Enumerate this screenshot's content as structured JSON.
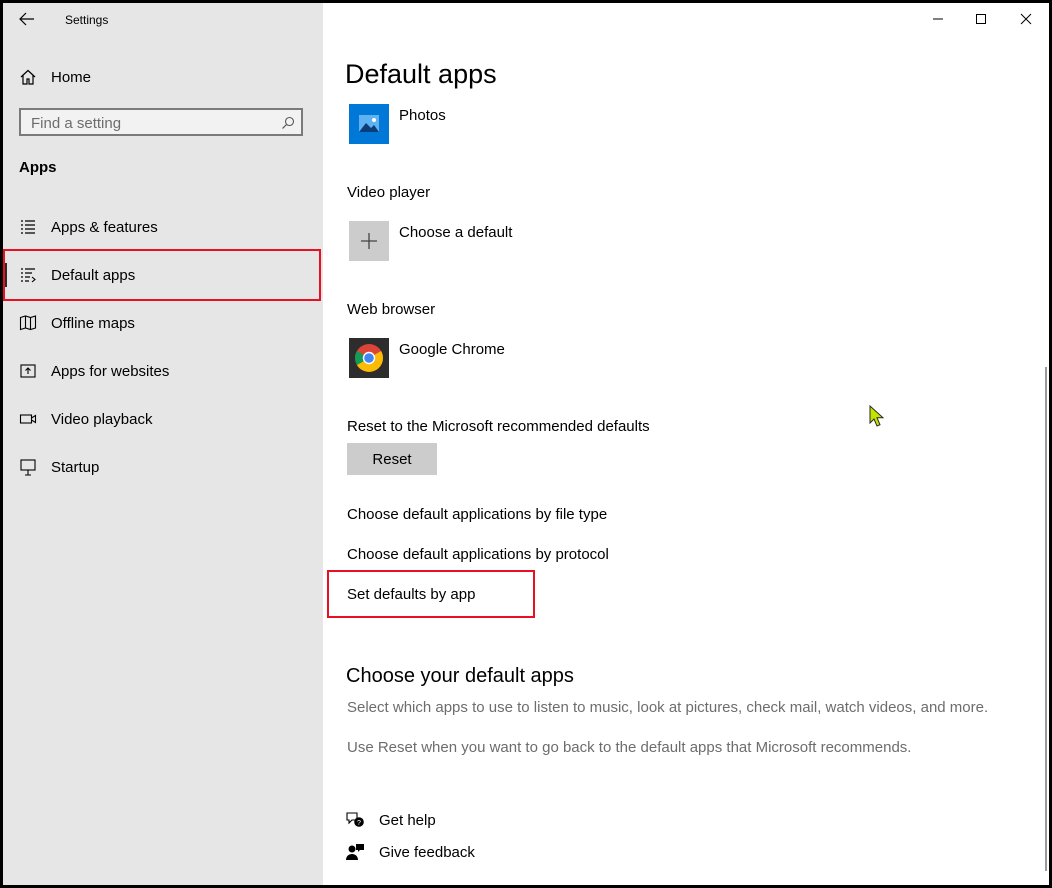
{
  "window": {
    "title": "Settings",
    "controls": {
      "minimize": "minimize",
      "maximize": "maximize",
      "close": "close"
    }
  },
  "sidebar": {
    "home_label": "Home",
    "search_placeholder": "Find a setting",
    "section_title": "Apps",
    "items": [
      {
        "label": "Apps & features",
        "icon": "apps-features-icon",
        "selected": false
      },
      {
        "label": "Default apps",
        "icon": "default-apps-icon",
        "selected": true
      },
      {
        "label": "Offline maps",
        "icon": "map-icon",
        "selected": false
      },
      {
        "label": "Apps for websites",
        "icon": "apps-websites-icon",
        "selected": false
      },
      {
        "label": "Video playback",
        "icon": "video-icon",
        "selected": false
      },
      {
        "label": "Startup",
        "icon": "startup-icon",
        "selected": false
      }
    ]
  },
  "main": {
    "title": "Default apps",
    "photo_viewer": {
      "app": "Photos"
    },
    "video_player": {
      "label": "Video player",
      "app": "Choose a default"
    },
    "web_browser": {
      "label": "Web browser",
      "app": "Google Chrome"
    },
    "reset": {
      "label": "Reset to the Microsoft recommended defaults",
      "button": "Reset"
    },
    "links": [
      "Choose default applications by file type",
      "Choose default applications by protocol",
      "Set defaults by app"
    ],
    "choose_section": {
      "title": "Choose your default apps",
      "desc1": "Select which apps to use to listen to music, look at pictures, check mail, watch videos, and more.",
      "desc2": "Use Reset when you want to go back to the default apps that Microsoft recommends."
    },
    "help": {
      "get_help": "Get help",
      "give_feedback": "Give feedback"
    }
  },
  "colors": {
    "accent": "#0078d7",
    "highlight_box": "#e81123",
    "sidebar_bg": "#e6e6e6"
  }
}
